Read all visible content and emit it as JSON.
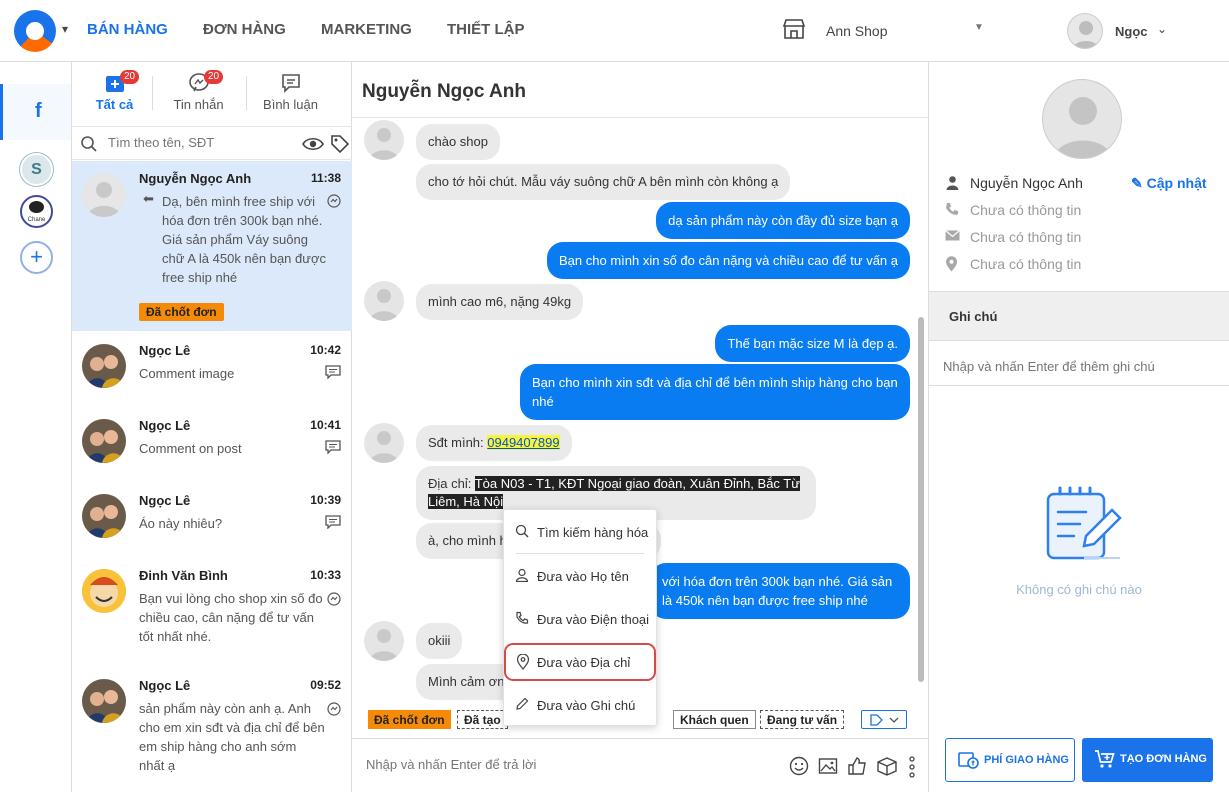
{
  "topnav": {
    "items": [
      {
        "label": "BÁN HÀNG",
        "active": true
      },
      {
        "label": "ĐƠN HÀNG",
        "active": false
      },
      {
        "label": "MARKETING",
        "active": false
      },
      {
        "label": "THIẾT LẬP",
        "active": false
      }
    ],
    "shop_name": "Ann Shop",
    "user_name": "Ngọc"
  },
  "rail": {
    "facebook_letter": "f",
    "avatar_letter": "S",
    "channel_label": "Chane",
    "add_symbol": "+"
  },
  "conversation_list": {
    "tabs": [
      {
        "label": "Tất cả",
        "badge": "20",
        "active": true
      },
      {
        "label": "Tin nhắn",
        "badge": "20",
        "active": false
      },
      {
        "label": "Bình luận",
        "badge": "",
        "active": false
      }
    ],
    "search_placeholder": "Tìm theo tên, SĐT",
    "items": [
      {
        "name": "Nguyễn Ngọc Anh",
        "time": "11:38",
        "preview": "Dạ, bên mình free ship với hóa đơn trên 300k bạn nhé. Giá sản phẩm Váy suông chữ A là 450k nên bạn được free ship nhé",
        "label": "Đã chốt đơn",
        "selected": true
      },
      {
        "name": "Ngọc Lê",
        "time": "10:42",
        "preview": "Comment image"
      },
      {
        "name": "Ngọc Lê",
        "time": "10:41",
        "preview": "Comment on post"
      },
      {
        "name": "Ngọc Lê",
        "time": "10:39",
        "preview": "Áo này nhiêu?"
      },
      {
        "name": "Đinh Văn Bình",
        "time": "10:33",
        "preview": "Bạn vui lòng cho shop xin số đo chiều cao, cân nặng để tư vấn tốt nhất nhé."
      },
      {
        "name": "Ngọc Lê",
        "time": "09:52",
        "preview": "sản phẩm này còn anh ạ. Anh cho em xin sđt và địa chỉ để bên em ship hàng cho anh sớm nhất ạ"
      }
    ]
  },
  "chat": {
    "title": "Nguyễn Ngọc Anh",
    "messages": [
      {
        "dir": "in",
        "text": "chào shop"
      },
      {
        "dir": "in",
        "text": "cho tớ hỏi chút. Mẫu váy suông chữ A bên mình còn không ạ"
      },
      {
        "dir": "out",
        "text": "dạ sản phẩm này còn đầy đủ size bạn ạ"
      },
      {
        "dir": "out",
        "text": "Bạn cho mình xin số đo cân nặng và chiều cao để tư vấn ạ"
      },
      {
        "dir": "in",
        "text": "mình cao m6, nặng 49kg"
      },
      {
        "dir": "out",
        "text": "Thế bạn mặc size M là đẹp ạ."
      },
      {
        "dir": "out",
        "text": "Bạn cho mình xin sđt và địa chỉ để bên mình ship hàng cho bạn nhé"
      },
      {
        "dir": "in",
        "prefix": "Sđt mình: ",
        "highlight": "0949407899"
      },
      {
        "dir": "in",
        "prefix": "Địa chỉ: ",
        "highlight": "Tòa N03 - T1, KĐT Ngoại giao đoàn, Xuân Đỉnh, Bắc Từ Liêm, Hà Nội"
      },
      {
        "dir": "in",
        "text": "à, cho mình h"
      },
      {
        "dir": "out",
        "text": "với hóa đơn trên 300k bạn nhé. Giá sản là 450k nên bạn được free ship nhé"
      },
      {
        "dir": "in",
        "text": "okiii"
      },
      {
        "dir": "in",
        "text": "Mình cảm ơn"
      }
    ],
    "tags": [
      "Đã chốt đơn",
      "Đã tạo",
      "Khách quen",
      "Đang tư vấn"
    ],
    "input_placeholder": "Nhập và nhấn Enter để trả lời"
  },
  "context_menu": {
    "items": [
      {
        "label": "Tìm kiếm hàng hóa",
        "icon": "search-icon"
      },
      {
        "label": "Đưa vào Họ tên",
        "icon": "person-icon"
      },
      {
        "label": "Đưa vào Điện thoại",
        "icon": "phone-icon"
      },
      {
        "label": "Đưa vào Địa chỉ",
        "icon": "location-icon",
        "highlighted": true
      },
      {
        "label": "Đưa vào Ghi chú",
        "icon": "pencil-icon"
      }
    ]
  },
  "customer": {
    "name": "Nguyễn Ngọc Anh",
    "update_label": "Cập nhật",
    "phone": "Chưa có thông tin",
    "email": "Chưa có thông tin",
    "address": "Chưa có thông tin",
    "notes_title": "Ghi chú",
    "notes_placeholder": "Nhập và nhấn Enter để thêm ghi chú",
    "no_notes": "Không có ghi chú nào",
    "ship_button": "PHÍ GIAO HÀNG",
    "order_button": "TẠO ĐƠN HÀNG"
  },
  "colors": {
    "accent": "#1a73e8",
    "outgoing_bubble": "#0a7cf2",
    "label_orange": "#f58a07",
    "selected_row": "#dbe9fb"
  }
}
